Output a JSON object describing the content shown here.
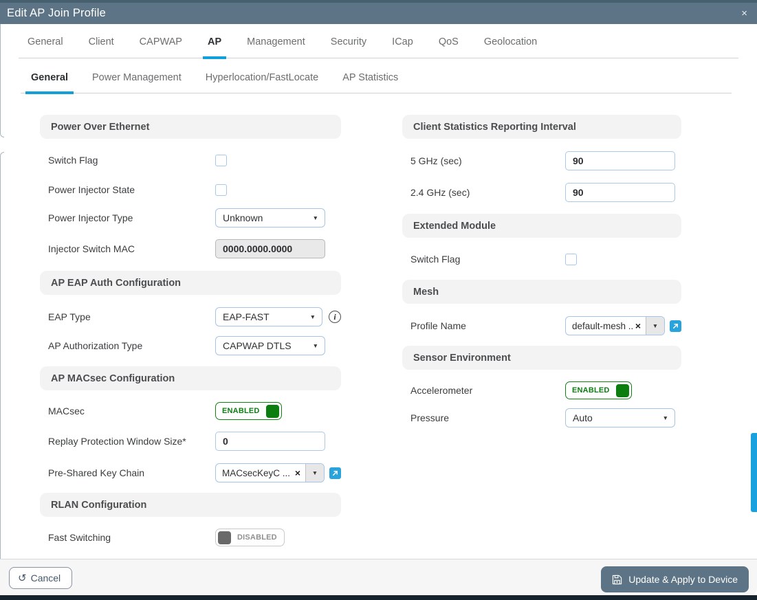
{
  "modal": {
    "title": "Edit AP Join Profile"
  },
  "icons": {
    "close": "×",
    "dropdown": "▼",
    "clear": "×",
    "undo": "↺",
    "info": "i"
  },
  "tabs": {
    "items": [
      "General",
      "Client",
      "CAPWAP",
      "AP",
      "Management",
      "Security",
      "ICap",
      "QoS",
      "Geolocation"
    ],
    "active": "AP"
  },
  "subtabs": {
    "items": [
      "General",
      "Power Management",
      "Hyperlocation/FastLocate",
      "AP Statistics"
    ],
    "active": "General"
  },
  "poe": {
    "title": "Power Over Ethernet",
    "switch_flag_label": "Switch Flag",
    "switch_flag_checked": false,
    "power_injector_state_label": "Power Injector State",
    "power_injector_state_checked": false,
    "power_injector_type_label": "Power Injector Type",
    "power_injector_type_value": "Unknown",
    "injector_switch_mac_label": "Injector Switch MAC",
    "injector_switch_mac_value": "0000.0000.0000"
  },
  "eap": {
    "title": "AP EAP Auth Configuration",
    "eap_type_label": "EAP Type",
    "eap_type_value": "EAP-FAST",
    "ap_auth_type_label": "AP Authorization Type",
    "ap_auth_type_value": "CAPWAP DTLS"
  },
  "macsec": {
    "title": "AP MACsec Configuration",
    "macsec_label": "MACsec",
    "macsec_state": "ENABLED",
    "replay_label": "Replay Protection Window Size*",
    "replay_value": "0",
    "psk_label": "Pre-Shared Key Chain",
    "psk_value": "MACsecKeyC ..."
  },
  "rlan": {
    "title": "RLAN Configuration",
    "fast_switching_label": "Fast Switching",
    "fast_switching_state": "DISABLED"
  },
  "client_stats": {
    "title": "Client Statistics Reporting Interval",
    "ghz5_label": "5 GHz (sec)",
    "ghz5_value": "90",
    "ghz24_label": "2.4 GHz (sec)",
    "ghz24_value": "90"
  },
  "extended_module": {
    "title": "Extended Module",
    "switch_flag_label": "Switch Flag",
    "switch_flag_checked": false
  },
  "mesh": {
    "title": "Mesh",
    "profile_name_label": "Profile Name",
    "profile_name_value": "default-mesh ..."
  },
  "sensor": {
    "title": "Sensor Environment",
    "accelerometer_label": "Accelerometer",
    "accelerometer_state": "ENABLED",
    "pressure_label": "Pressure",
    "pressure_value": "Auto"
  },
  "footer": {
    "cancel_label": "Cancel",
    "apply_label": "Update & Apply to Device"
  },
  "colors": {
    "header_bg": "#5d7486",
    "accent_blue": "#119fd9",
    "enabled_green": "#0c7e10",
    "disabled_gray": "#696969",
    "section_bg": "#f3f3f3"
  }
}
